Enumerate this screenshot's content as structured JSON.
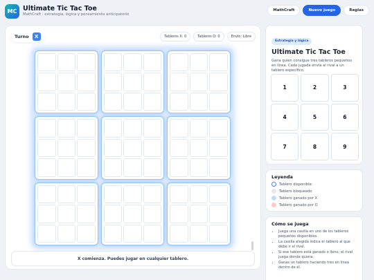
{
  "header": {
    "logo": "MC",
    "title": "Ultimate Tic Tac Toe",
    "subtitle": "MathCraft · estrategia, lógica y pensamiento anticipatorio",
    "nav": [
      "MathCraft",
      "Nuevo juego",
      "Reglas"
    ]
  },
  "game": {
    "turn_label": "Turno",
    "turn_player": "X",
    "stats": [
      "Tableros X: 0",
      "Tableros O: 0",
      "Envío: Libre"
    ],
    "status": "X comienza. Puedes jugar en cualquier tablero."
  },
  "board": {
    "boards": [
      [
        "",
        "",
        "",
        "",
        "",
        "",
        "",
        "",
        ""
      ],
      [
        "",
        "",
        "",
        "",
        "",
        "",
        "",
        "",
        ""
      ],
      [
        "",
        "",
        "",
        "",
        "",
        "",
        "",
        "",
        ""
      ],
      [
        "",
        "",
        "",
        "",
        "",
        "",
        "",
        "",
        ""
      ],
      [
        "",
        "",
        "",
        "",
        "",
        "",
        "",
        "",
        ""
      ],
      [
        "",
        "",
        "",
        "",
        "",
        "",
        "",
        "",
        ""
      ],
      [
        "",
        "",
        "",
        "",
        "",
        "",
        "",
        "",
        ""
      ],
      [
        "",
        "",
        "",
        "",
        "",
        "",
        "",
        "",
        ""
      ],
      [
        "",
        "",
        "",
        "",
        "",
        "",
        "",
        "",
        ""
      ]
    ]
  },
  "sidebar": {
    "tag": "Estrategia y lógica",
    "title": "Ultimate Tic Tac Toe",
    "description": "Gana quien consigue tres tableros pequeños en línea. Cada jugada envía al rival a un tablero específico.",
    "map": [
      "1",
      "2",
      "3",
      "4",
      "5",
      "6",
      "7",
      "8",
      "9"
    ],
    "legend_title": "Leyenda",
    "legend": [
      "Tablero disponible",
      "Tablero bloqueado",
      "Tablero ganado por X",
      "Tablero ganado por O"
    ],
    "rules_title": "Cómo se juega",
    "rules": [
      "Juega una casilla en uno de los tableros pequeños disponibles.",
      "La casilla elegida indica el tablero al que debe ir el rival.",
      "Si ese tablero está ganado o lleno, el rival juega donde quiera.",
      "Ganas un tablero haciendo tres en línea dentro de él."
    ]
  },
  "colors": {
    "accent": "#2563eb",
    "x_color": "#3b82f6",
    "board_border": "#93c5fd",
    "won_x": "#bfdbfe",
    "won_o": "#fecaca",
    "locked": "#e5e7eb"
  }
}
